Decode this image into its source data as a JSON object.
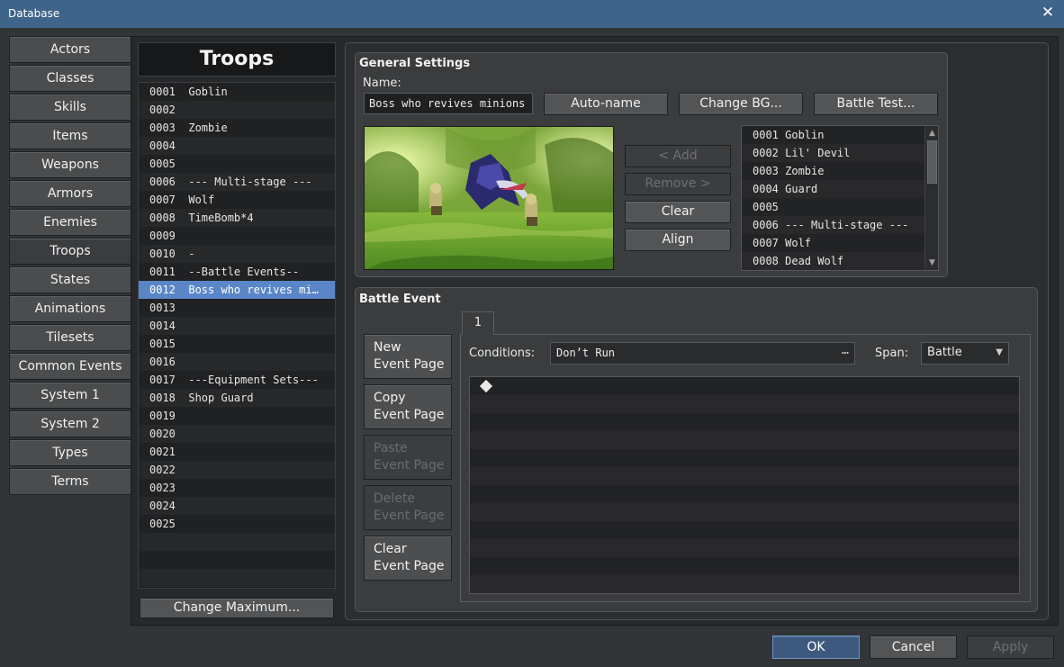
{
  "window": {
    "title": "Database",
    "close_glyph": "✕"
  },
  "categories": [
    {
      "label": "Actors"
    },
    {
      "label": "Classes"
    },
    {
      "label": "Skills"
    },
    {
      "label": "Items"
    },
    {
      "label": "Weapons"
    },
    {
      "label": "Armors"
    },
    {
      "label": "Enemies"
    },
    {
      "label": "Troops",
      "active": true
    },
    {
      "label": "States"
    },
    {
      "label": "Animations"
    },
    {
      "label": "Tilesets"
    },
    {
      "label": "Common Events"
    },
    {
      "label": "System 1"
    },
    {
      "label": "System 2"
    },
    {
      "label": "Types"
    },
    {
      "label": "Terms"
    }
  ],
  "troops": {
    "header": "Troops",
    "selected_index": 11,
    "items": [
      "0001  Goblin",
      "0002",
      "0003  Zombie",
      "0004",
      "0005",
      "0006  --- Multi-stage ---",
      "0007  Wolf",
      "0008  TimeBomb*4",
      "0009",
      "0010  -",
      "0011  --Battle Events--",
      "0012  Boss who revives mi…",
      "0013",
      "0014",
      "0015",
      "0016",
      "0017  ---Equipment Sets---",
      "0018  Shop Guard",
      "0019",
      "0020",
      "0021",
      "0022",
      "0023",
      "0024",
      "0025"
    ],
    "change_max_label": "Change Maximum..."
  },
  "general": {
    "title": "General Settings",
    "name_label": "Name:",
    "name_value": "Boss who revives minions",
    "auto_name": "Auto-name",
    "change_bg": "Change BG...",
    "battle_test": "Battle Test...",
    "add": "< Add",
    "remove": "Remove >",
    "clear": "Clear",
    "align": "Align",
    "enemies": [
      "0001 Goblin",
      "0002 Lil' Devil",
      "0003 Zombie",
      "0004 Guard",
      "0005",
      "0006 --- Multi-stage ---",
      "0007 Wolf",
      "0008 Dead Wolf"
    ]
  },
  "battle_event": {
    "title": "Battle Event",
    "new_page": [
      "New",
      "Event Page"
    ],
    "copy_page": [
      "Copy",
      "Event Page"
    ],
    "paste_page": [
      "Paste",
      "Event Page"
    ],
    "delete_page": [
      "Delete",
      "Event Page"
    ],
    "clear_page": [
      "Clear",
      "Event Page"
    ],
    "tab": "1",
    "conditions_label": "Conditions:",
    "conditions_value": "Don’t Run",
    "span_label": "Span:",
    "span_value": "Battle"
  },
  "footer": {
    "ok": "OK",
    "cancel": "Cancel",
    "apply": "Apply"
  },
  "colors": {
    "titlebar": "#3f6489",
    "selection": "#5a86c7",
    "ok_border": "#6f94c4"
  }
}
